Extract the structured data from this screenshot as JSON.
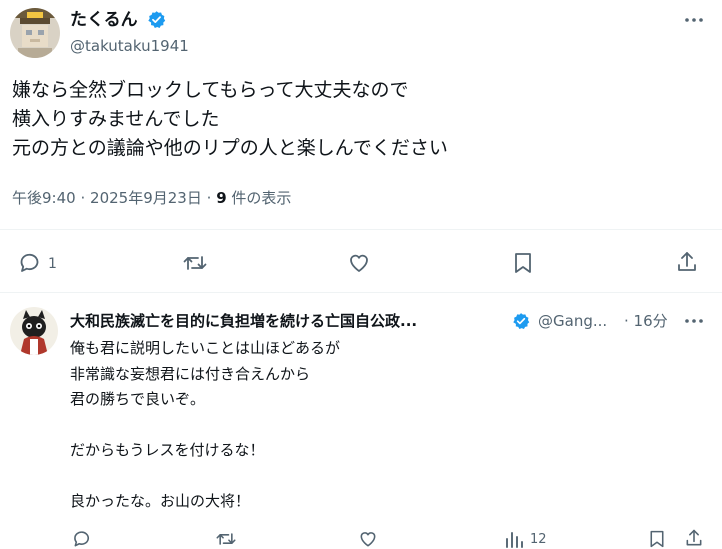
{
  "main_post": {
    "author_name": "たくるん",
    "handle": "@takutaku1941",
    "verified": true,
    "text_lines": [
      "嫌なら全然ブロックしてもらって大丈夫なので",
      "横入りすみませんでした",
      "元の方との議論や他のリプの人と楽しんでください"
    ],
    "time": "午後9:40",
    "separator": "·",
    "date": "2025年9月23日",
    "views_count": "9",
    "views_label": "件の表示",
    "reply_count": "1"
  },
  "reply_post": {
    "author_name": "大和民族滅亡を目的に負担増を続ける亡国自公政...",
    "handle": "@Gang...",
    "verified": true,
    "time_ago": "· 16分",
    "text_lines": [
      "俺も君に説明したいことは山ほどあるが",
      "非常識な妄想君には付き合えんから",
      "君の勝ちで良いぞ。",
      "",
      "だからもうレスを付けるな！",
      "",
      "良かったな。お山の大将！"
    ],
    "views_count": "12"
  },
  "colors": {
    "text": "#0f1419",
    "secondary": "#536471",
    "verified": "#1d9bf0",
    "divider": "#eff3f4"
  },
  "icons": [
    "more-icon",
    "verified-icon",
    "reply-icon",
    "retweet-icon",
    "like-icon",
    "bookmark-icon",
    "share-icon",
    "views-icon"
  ]
}
